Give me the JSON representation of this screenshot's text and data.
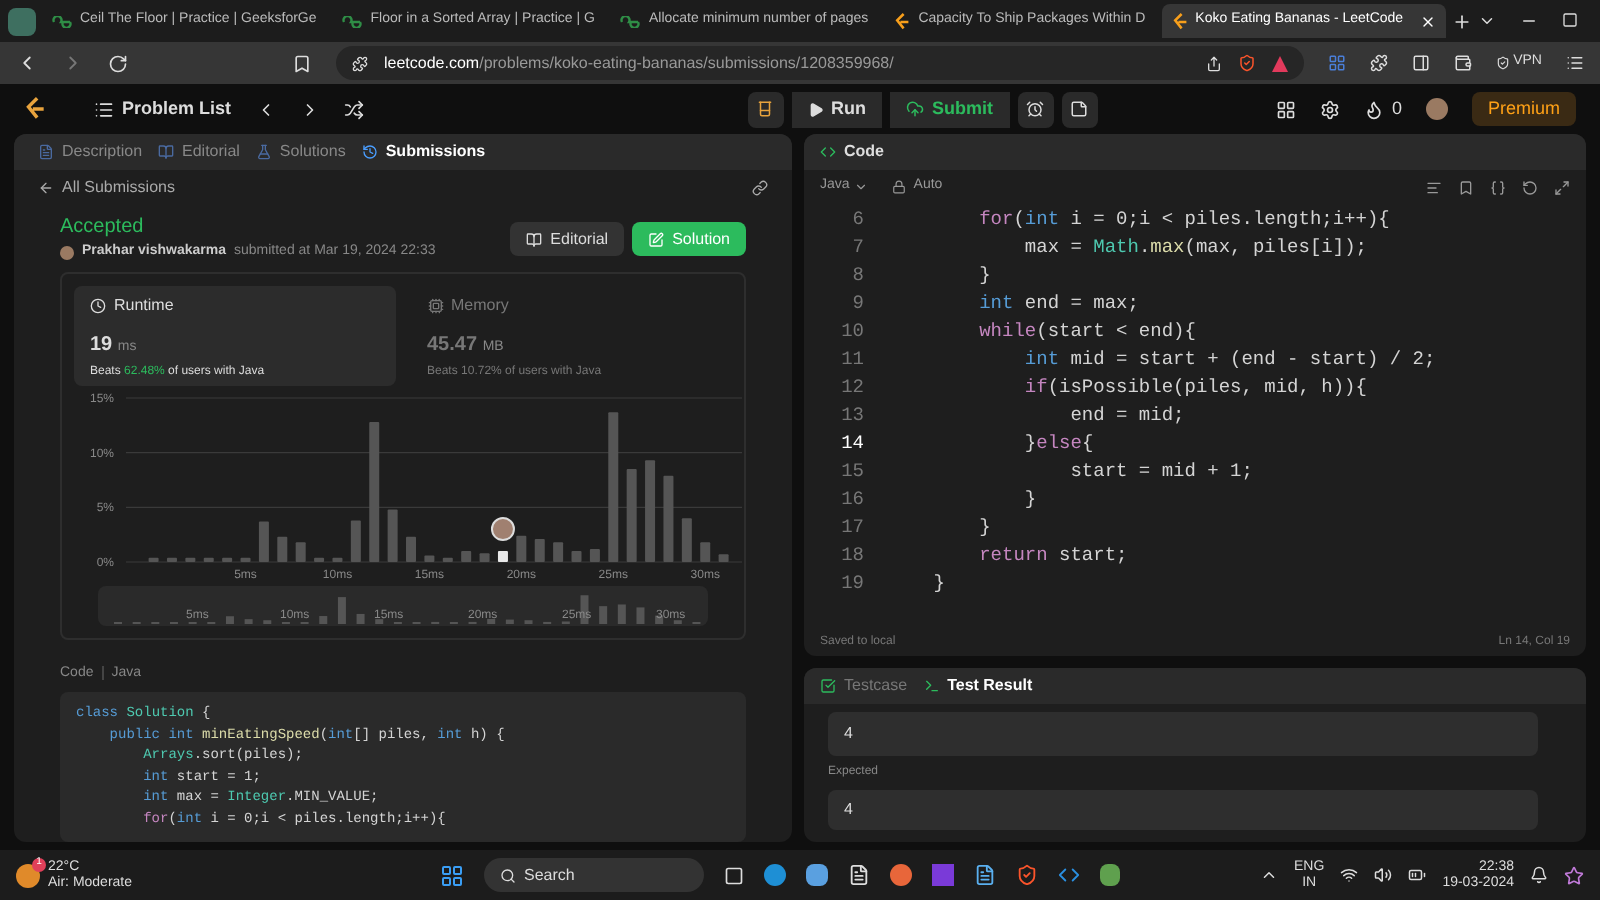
{
  "browser": {
    "tabs": [
      {
        "title": "Ceil The Floor | Practice | GeeksforGe",
        "kind": "gfg",
        "selected": false
      },
      {
        "title": "Floor in a Sorted Array | Practice | G",
        "kind": "gfg",
        "selected": false
      },
      {
        "title": "Allocate minimum number of pages",
        "kind": "gfg",
        "selected": false
      },
      {
        "title": "Capacity To Ship Packages Within D",
        "kind": "leetcode",
        "selected": false
      },
      {
        "title": "Koko Eating Bananas - LeetCode",
        "kind": "leetcode",
        "selected": true
      }
    ],
    "url_domain": "leetcode.com",
    "url_path": "/problems/koko-eating-bananas/submissions/1208359968/",
    "vpn": "VPN"
  },
  "toolbar": {
    "problem_list": "Problem List",
    "run": "Run",
    "submit": "Submit",
    "streak": "0",
    "premium": "Premium"
  },
  "left_panel": {
    "tabs": [
      {
        "label": "Description",
        "selected": false
      },
      {
        "label": "Editorial",
        "selected": false
      },
      {
        "label": "Solutions",
        "selected": false
      },
      {
        "label": "Submissions",
        "selected": true
      }
    ],
    "back": "All Submissions",
    "status": "Accepted",
    "author": "Prakhar vishwakarma",
    "submitted": "submitted at Mar 19, 2024 22:33",
    "editorial_button": "Editorial",
    "solution_button": "Solution",
    "stats": [
      {
        "title": "Runtime",
        "value": "19",
        "unit": "ms",
        "beats": "Beats",
        "percent": "62.48%",
        "suffix": "of users with Java",
        "selected": true
      },
      {
        "title": "Memory",
        "value": "45.47",
        "unit": "MB",
        "beats": "Beats",
        "percent": "10.72%",
        "suffix": "of users with Java",
        "selected": false
      }
    ],
    "chart_data": {
      "type": "bar",
      "x": [
        0,
        1,
        2,
        3,
        4,
        5,
        6,
        7,
        8,
        9,
        10,
        11,
        12,
        13,
        14,
        15,
        16,
        17,
        18,
        19,
        20,
        21,
        22,
        23,
        24,
        25,
        26,
        27,
        28,
        29,
        30,
        31
      ],
      "values": [
        0.4,
        0.4,
        0.4,
        0.4,
        0.4,
        0.4,
        3.7,
        2.3,
        1.8,
        0.4,
        0.4,
        3.8,
        12.8,
        4.8,
        2.3,
        0.6,
        0.4,
        1.0,
        0.8,
        1.0,
        2.4,
        2.1,
        1.8,
        1.0,
        1.2,
        13.7,
        8.5,
        9.3,
        7.9,
        4.0,
        1.8,
        0.7
      ],
      "xlim": [
        -1.5,
        32
      ],
      "ylim": [
        0,
        15
      ],
      "yticks": [
        {
          "value": 0,
          "label": "0%"
        },
        {
          "value": 5,
          "label": "5%"
        },
        {
          "value": 10,
          "label": "10%"
        },
        {
          "value": 15,
          "label": "15%"
        }
      ],
      "xticks": [
        {
          "value": 5,
          "label": "5ms"
        },
        {
          "value": 10,
          "label": "10ms"
        },
        {
          "value": 15,
          "label": "15ms"
        },
        {
          "value": 20,
          "label": "20ms"
        },
        {
          "value": 25,
          "label": "25ms"
        },
        {
          "value": 30,
          "label": "30ms"
        }
      ]
    },
    "overview_labels": [
      "5ms",
      "10ms",
      "15ms",
      "20ms",
      "25ms",
      "30ms"
    ],
    "code_label": "Code",
    "code_language": "Java",
    "code": [
      [
        {
          "text": "class ",
          "kind": "kw"
        },
        {
          "text": "Solution",
          "kind": "cls"
        },
        {
          "text": " {",
          "kind": "pl"
        }
      ],
      [
        {
          "text": "    public int ",
          "kind": "kw"
        },
        {
          "text": "minEatingSpeed",
          "kind": "fn"
        },
        {
          "text": "(",
          "kind": "pl"
        },
        {
          "text": "int",
          "kind": "kw"
        },
        {
          "text": "[] piles, ",
          "kind": "pl"
        },
        {
          "text": "int",
          "kind": "kw"
        },
        {
          "text": " h) {",
          "kind": "pl"
        }
      ],
      [
        {
          "text": "        Arrays",
          "kind": "cls"
        },
        {
          "text": ".sort(piles);",
          "kind": "pl"
        }
      ],
      [
        {
          "text": "        int",
          "kind": "kw"
        },
        {
          "text": " start = 1;",
          "kind": "pl"
        }
      ],
      [
        {
          "text": "        int",
          "kind": "kw"
        },
        {
          "text": " max = ",
          "kind": "pl"
        },
        {
          "text": "Integer",
          "kind": "cls"
        },
        {
          "text": ".MIN_VALUE;",
          "kind": "pl"
        }
      ],
      [
        {
          "text": "        for",
          "kind": "ctl"
        },
        {
          "text": "(",
          "kind": "pl"
        },
        {
          "text": "int",
          "kind": "kw"
        },
        {
          "text": " i = 0;i < piles.length;i++){",
          "kind": "pl"
        }
      ]
    ]
  },
  "editor": {
    "title": "Code",
    "language": "Java",
    "mode": "Auto",
    "lines": [
      {
        "n": "6",
        "active": false,
        "seg": [
          {
            "text": "        for",
            "kind": "ctl"
          },
          {
            "text": "(",
            "kind": "pl"
          },
          {
            "text": "int",
            "kind": "kw"
          },
          {
            "text": " i = 0;i < piles.length;i++){",
            "kind": "pl"
          }
        ]
      },
      {
        "n": "7",
        "active": false,
        "seg": [
          {
            "text": "            max = ",
            "kind": "pl"
          },
          {
            "text": "Math",
            "kind": "cls"
          },
          {
            "text": ".",
            "kind": "pl"
          },
          {
            "text": "max",
            "kind": "fn"
          },
          {
            "text": "(max, piles[i]);",
            "kind": "pl"
          }
        ]
      },
      {
        "n": "8",
        "active": false,
        "seg": [
          {
            "text": "        }",
            "kind": "pl"
          }
        ]
      },
      {
        "n": "9",
        "active": false,
        "seg": [
          {
            "text": "        int",
            "kind": "kw"
          },
          {
            "text": " end = max;",
            "kind": "pl"
          }
        ]
      },
      {
        "n": "10",
        "active": false,
        "seg": [
          {
            "text": "        while",
            "kind": "ctl"
          },
          {
            "text": "(start < end){",
            "kind": "pl"
          }
        ]
      },
      {
        "n": "11",
        "active": false,
        "seg": [
          {
            "text": "            int",
            "kind": "kw"
          },
          {
            "text": " mid = start + (end - start) / 2;",
            "kind": "pl"
          }
        ]
      },
      {
        "n": "12",
        "active": false,
        "seg": [
          {
            "text": "            if",
            "kind": "ctl"
          },
          {
            "text": "(isPossible(piles, mid, h)){",
            "kind": "pl"
          }
        ]
      },
      {
        "n": "13",
        "active": false,
        "seg": [
          {
            "text": "                end = mid;",
            "kind": "pl"
          }
        ]
      },
      {
        "n": "14",
        "active": true,
        "seg": [
          {
            "text": "            }",
            "kind": "pl"
          },
          {
            "text": "else",
            "kind": "ctl"
          },
          {
            "text": "{",
            "kind": "pl"
          }
        ]
      },
      {
        "n": "15",
        "active": false,
        "seg": [
          {
            "text": "                start = mid + 1;",
            "kind": "pl"
          }
        ]
      },
      {
        "n": "16",
        "active": false,
        "seg": [
          {
            "text": "            }",
            "kind": "pl"
          }
        ]
      },
      {
        "n": "17",
        "active": false,
        "seg": [
          {
            "text": "        }",
            "kind": "pl"
          }
        ]
      },
      {
        "n": "18",
        "active": false,
        "seg": [
          {
            "text": "        return",
            "kind": "ctl"
          },
          {
            "text": " start;",
            "kind": "pl"
          }
        ]
      },
      {
        "n": "19",
        "active": false,
        "seg": [
          {
            "text": "    }",
            "kind": "pl"
          }
        ]
      }
    ],
    "saved": "Saved to local",
    "position": "Ln 14, Col 19"
  },
  "test_panel": {
    "tabs": [
      {
        "label": "Testcase",
        "selected": false
      },
      {
        "label": "Test Result",
        "selected": true
      }
    ],
    "output": "4",
    "expected_label": "Expected",
    "expected": "4"
  },
  "taskbar": {
    "weather_badge": "1",
    "temperature": "22°C",
    "air": "Air: Moderate",
    "search": "Search",
    "lang": "ENG",
    "region": "IN",
    "time": "22:38",
    "date": "19-03-2024"
  }
}
